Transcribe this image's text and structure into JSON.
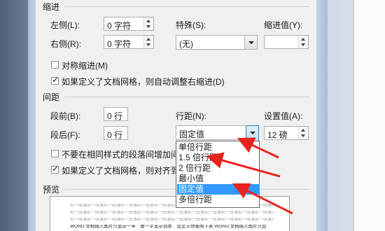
{
  "indent": {
    "title": "缩进",
    "left_label": "左侧(L):",
    "left_value": "0 字符",
    "right_label": "右侧(R):",
    "right_value": "0 字符",
    "special_label": "特殊(S):",
    "special_value": "(无)",
    "indent_value_label": "缩进值(Y):",
    "mirror_label": "对称缩进(M)",
    "grid_label": "如果定义了文档网格，则自动调整右缩进(D)"
  },
  "spacing": {
    "title": "间距",
    "before_label": "段前(B):",
    "before_value": "0 行",
    "after_label": "段后(F):",
    "after_value": "0 行",
    "line_spacing_label": "行距(N):",
    "line_spacing_value": "固定值",
    "setting_label": "设置值(A):",
    "setting_value": "12 磅",
    "no_space_label": "不要在相同样式的段落间增加间",
    "snap_grid_label": "如果定义了文档网格，则对齐到"
  },
  "dropdown_options": [
    "单倍行距",
    "1.5 倍行距",
    "2 倍行距",
    "最小值",
    "固定值",
    "多倍行距"
  ],
  "preview": {
    "title": "预览",
    "sample_line": "前一段落前一段落前一段落前一段落前一段落前一段落前一段落前一段落前一段落前一段落前一段落前一段落前一段落",
    "dark_line": "WORD 文档插入图片只显示一半　要一字显示到本　忽定义你要两下表 WORD 文档插入图片只显"
  },
  "colors": {
    "selection": "#3399ff",
    "arrow": "#e8231f"
  }
}
